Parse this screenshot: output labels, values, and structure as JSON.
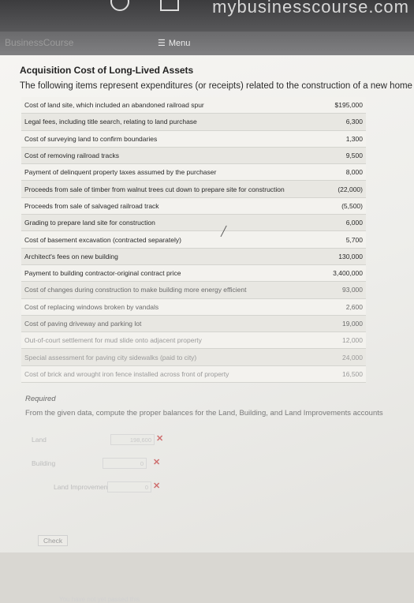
{
  "browser": {
    "site_text": "mybusinesscourse.com"
  },
  "navbar": {
    "brand_text": "BusinessCourse",
    "menu_icon": "hamburger-icon",
    "menu_label": "Menu"
  },
  "problem": {
    "title": "Acquisition Cost of Long-Lived Assets",
    "intro": "The following items represent expenditures (or receipts) related to the construction of a new home office",
    "items": [
      {
        "desc": "Cost of land site, which included an abandoned railroad spur",
        "amount": "$195,000"
      },
      {
        "desc": "Legal fees, including title search, relating to land purchase",
        "amount": "6,300"
      },
      {
        "desc": "Cost of surveying land to confirm boundaries",
        "amount": "1,300"
      },
      {
        "desc": "Cost of removing railroad tracks",
        "amount": "9,500"
      },
      {
        "desc": "Payment of delinquent property taxes assumed by the purchaser",
        "amount": "8,000"
      },
      {
        "desc": "Proceeds from sale of timber from walnut trees cut down to prepare site for construction",
        "amount": "(22,000)"
      },
      {
        "desc": "Proceeds from sale of salvaged railroad track",
        "amount": "(5,500)"
      },
      {
        "desc": "Grading to prepare land site for construction",
        "amount": "6,000"
      },
      {
        "desc": "Cost of basement excavation (contracted separately)",
        "amount": "5,700"
      },
      {
        "desc": "Architect's fees on new building",
        "amount": "130,000"
      },
      {
        "desc": "Payment to building contractor-original contract price",
        "amount": "3,400,000"
      },
      {
        "desc": "Cost of changes during construction to make building more energy efficient",
        "amount": "93,000"
      },
      {
        "desc": "Cost of replacing windows broken by vandals",
        "amount": "2,600"
      },
      {
        "desc": "Cost of paving driveway and parking lot",
        "amount": "19,000"
      },
      {
        "desc": "Out-of-court settlement for mud slide onto adjacent property",
        "amount": "12,000"
      },
      {
        "desc": "Special assessment for paving city sidewalks (paid to city)",
        "amount": "24,000"
      },
      {
        "desc": "Cost of brick and wrought iron fence installed across front of property",
        "amount": "16,500"
      }
    ]
  },
  "required": {
    "label": "Required",
    "instruction": "From the given data, compute the proper balances for the Land, Building, and Land Improvements accounts"
  },
  "answers": [
    {
      "label": "Land",
      "value": "198,600",
      "mark": "✕"
    },
    {
      "label": "Building",
      "value": "0",
      "mark": "✕"
    },
    {
      "label": "Land Improvements",
      "value": "0",
      "mark": "✕"
    }
  ],
  "actions": {
    "check_label": "Check"
  },
  "footer": {
    "note": "You have not yet passed this"
  },
  "colors": {
    "error_mark": "#cf6f6f",
    "top_bar": "#3c3c3e",
    "nav_bar": "#6a6a6c"
  }
}
